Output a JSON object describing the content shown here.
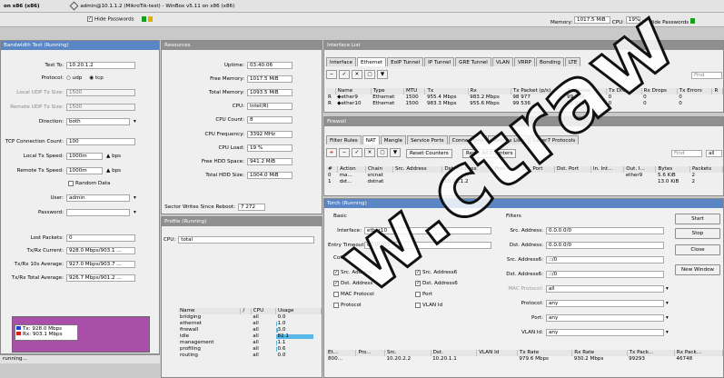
{
  "app": {
    "window_title": "admin@10.1.1.2 (MikroTik-test) - WinBox v5.11 on x86 (x86)",
    "left_title": "on x86 (x86)",
    "hide_passwords": "Hide Passwords",
    "memory_label": "Memory:",
    "memory_value": "1017.5 MiB",
    "cpu_label": "CPU:",
    "cpu_value": "19%",
    "hide_passwords_right": "Hide Passwords",
    "status": "running..."
  },
  "bandwidth_test": {
    "title": "Bandwidth Test (Running)",
    "fields": [
      {
        "label": "Test To:",
        "value": "10.20.1.2"
      },
      {
        "label": "Protocol:",
        "value": ""
      },
      {
        "label": "Local UDP Tx Size:",
        "value": "1500"
      },
      {
        "label": "Remote UDP Tx Size:",
        "value": "1500"
      },
      {
        "label": "Direction:",
        "value": "both"
      },
      {
        "label": "TCP Connection Count:",
        "value": "100"
      },
      {
        "label": "Local Tx Speed:",
        "value": "1000m"
      },
      {
        "label": "Remote Tx Speed:",
        "value": "1000m"
      },
      {
        "label": "User:",
        "value": "admin"
      },
      {
        "label": "Password:",
        "value": ""
      },
      {
        "label": "Lost Packets:",
        "value": "0"
      },
      {
        "label": "Tx/Rx Current:",
        "value": "928.0 Mbps/903.1 ..."
      },
      {
        "label": "Tx/Rx 10s Average:",
        "value": "927.0 Mbps/903.7 ..."
      },
      {
        "label": "Tx/Rx Total Average:",
        "value": "926.7 Mbps/901.2 ..."
      }
    ],
    "proto_udp": "udp",
    "proto_tcp": "tcp",
    "unit": "bps",
    "random_data": "Random Data",
    "legend_tx": "Tx:  928.0 Mbps",
    "legend_rx": "Rx:  903.1 Mbps"
  },
  "resources": {
    "title": "Resources",
    "rows": [
      {
        "label": "Uptime:",
        "value": "03:40:06"
      },
      {
        "label": "Free Memory:",
        "value": "1017.5 MiB"
      },
      {
        "label": "Total Memory:",
        "value": "1093.5 MiB"
      },
      {
        "label": "CPU:",
        "value": "Intel(R)"
      },
      {
        "label": "CPU Count:",
        "value": "8"
      },
      {
        "label": "CPU Frequency:",
        "value": "3392 MHz"
      },
      {
        "label": "CPU Load:",
        "value": "19 %"
      },
      {
        "label": "Free HDD Space:",
        "value": "941.2 MiB"
      },
      {
        "label": "Total HDD Size:",
        "value": "1004.0 MiB"
      },
      {
        "label": "Sector Writes Since Reboot:",
        "value": "7 272"
      }
    ]
  },
  "profile": {
    "title": "Profile (Running)",
    "cpu_label": "CPU:",
    "cpu_value": "total",
    "columns": [
      "Name",
      "/",
      "CPU",
      "Usage"
    ],
    "rows": [
      {
        "name": "bridging",
        "cpu": "all",
        "usage": "0.0",
        "bar": 0.0
      },
      {
        "name": "ethernet",
        "cpu": "all",
        "usage": "1.0",
        "bar": 0.02
      },
      {
        "name": "firewall",
        "cpu": "all",
        "usage": "3.0",
        "bar": 0.04
      },
      {
        "name": "idle",
        "cpu": "all",
        "usage": "82.1",
        "bar": 0.82
      },
      {
        "name": "management",
        "cpu": "all",
        "usage": "1.1",
        "bar": 0.02
      },
      {
        "name": "profiling",
        "cpu": "all",
        "usage": "0.6",
        "bar": 0.01
      },
      {
        "name": "routing",
        "cpu": "all",
        "usage": "0.0",
        "bar": 0.0
      }
    ]
  },
  "interface_list": {
    "title": "Interface List",
    "tabs": [
      "Interface",
      "Ethernet",
      "EoIP Tunnel",
      "IP Tunnel",
      "GRE Tunnel",
      "VLAN",
      "VRRP",
      "Bonding",
      "LTE"
    ],
    "find": "Find",
    "columns": [
      "Name",
      "Type",
      "MTU",
      "Tx",
      "Rx",
      "Tx Packet (p/s)",
      "Rx Packe...",
      "Tx Drops",
      "Rx Drops",
      "Tx Errors",
      "R"
    ],
    "rows": [
      {
        "flag": "R",
        "name": "ether9",
        "type": "Ethernet",
        "mtu": "1500",
        "tx": "955.4 Mbps",
        "rx": "983.2 Mbps",
        "txp": "98 977",
        "rxp": "99 692",
        "txd": "0",
        "rxd": "0",
        "txe": "0"
      },
      {
        "flag": "R",
        "name": "ether10",
        "type": "Ethernet",
        "mtu": "1500",
        "tx": "983.3 Mbps",
        "rx": "955.6 Mbps",
        "txp": "99 536",
        "rxp": "98 965",
        "txd": "0",
        "rxd": "0",
        "txe": "0"
      }
    ]
  },
  "firewall": {
    "title": "Firewall",
    "tabs": [
      "Filter Rules",
      "NAT",
      "Mangle",
      "Service Ports",
      "Connections",
      "Address Lists",
      "Layer7 Protocols"
    ],
    "reset_counters": "Reset Counters",
    "reset_all_counters": "Reset All Counters",
    "find": "Find",
    "find_value": "all",
    "columns": [
      "#",
      "Action",
      "Chain",
      "Src. Address",
      "Dst. Address",
      "Prot...",
      "Src. Port",
      "Dst. Port",
      "In. Int...",
      "Out. I...",
      "Bytes",
      "Packets"
    ],
    "rows": [
      {
        "num": "0",
        "action": "ma...",
        "chain": "srcnat",
        "dst": "",
        "out": "ether9",
        "bytes": "5.6 KiB",
        "packets": "2"
      },
      {
        "num": "1",
        "action": "dst...",
        "chain": "dstnat",
        "dst": "10.20.1.2",
        "out": "",
        "bytes": "13.0 KiB",
        "packets": "2"
      }
    ]
  },
  "torch": {
    "title": "Torch (Running)",
    "basic": "Basic",
    "interface_label": "Interface:",
    "interface_value": "ether10",
    "entry_timeout_label": "Entry Timeout:",
    "entry_timeout_value": "00:00:03",
    "collect": "Collect",
    "checks": [
      {
        "label": "Src. Address",
        "on": true
      },
      {
        "label": "Src. Address6",
        "on": true
      },
      {
        "label": "Dst. Address",
        "on": true
      },
      {
        "label": "Dst. Address6",
        "on": true
      },
      {
        "label": "MAC Protocol",
        "on": false
      },
      {
        "label": "Port",
        "on": false
      },
      {
        "label": "Protocol",
        "on": false
      },
      {
        "label": "VLAN Id",
        "on": false
      }
    ],
    "filters": "Filters",
    "filter_rows": [
      {
        "label": "Src. Address:",
        "value": "0.0.0.0/0"
      },
      {
        "label": "Dst. Address:",
        "value": "0.0.0.0/0"
      },
      {
        "label": "Src. Address6:",
        "value": "::/0"
      },
      {
        "label": "Dst. Address6:",
        "value": "::/0"
      },
      {
        "label": "MAC Protocol:",
        "value": "all"
      },
      {
        "label": "Protocol:",
        "value": "any"
      },
      {
        "label": "Port:",
        "value": "any"
      },
      {
        "label": "VLAN Id:",
        "value": "any"
      }
    ],
    "buttons": [
      "Start",
      "Stop",
      "Close",
      "New Window"
    ],
    "columns": [
      "Et...",
      "Pro...",
      "Src.",
      "Dst.",
      "VLAN Id",
      "Tx Rate",
      "Rx Rate",
      "Tx Pack...",
      "Rx Pack..."
    ],
    "rows": [
      {
        "eth": "800...",
        "proto": "",
        "src": "10.20.2.2",
        "dst": "10.20.1.1",
        "vlan": "",
        "tx": "979.6 Mbps",
        "rx": "930.2 Mbps",
        "txp": "99293",
        "rxp": "46748"
      }
    ]
  },
  "watermark": "w.ctraw"
}
